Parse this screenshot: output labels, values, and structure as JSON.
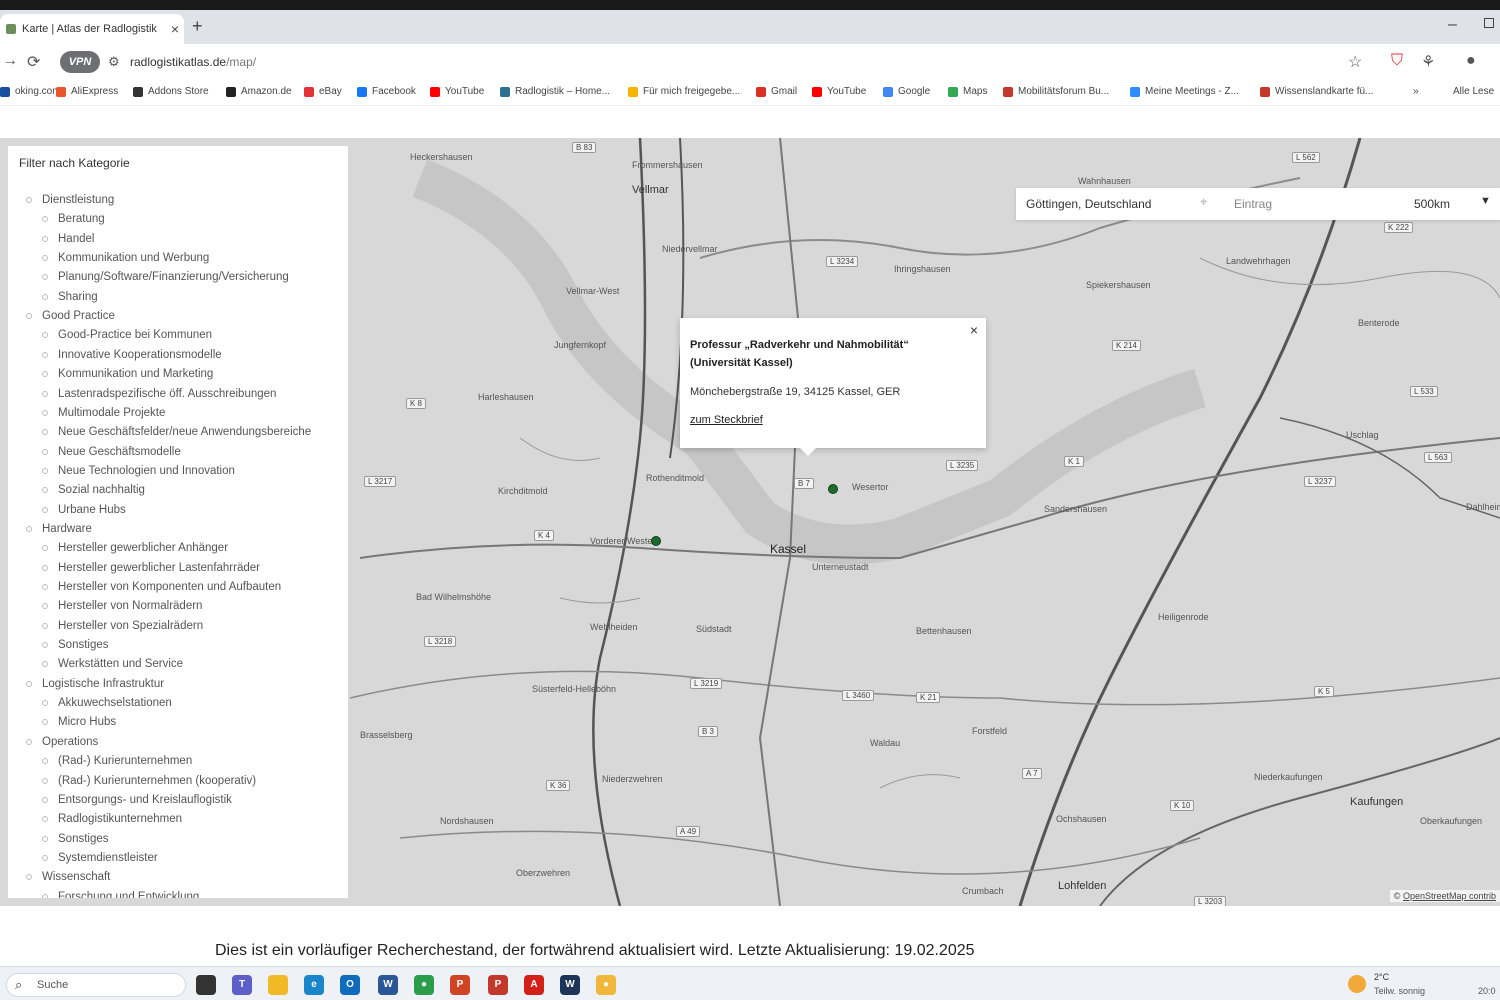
{
  "browser": {
    "tab_title": "Karte | Atlas der Radlogistik",
    "tab_close": "×",
    "new_tab": "+",
    "minimize": "–",
    "vpn_label": "VPN",
    "url_host": "radlogistikatlas.de",
    "url_path": "/map/"
  },
  "bookmarks": [
    {
      "label": "oking.com",
      "color": "#1a4fa0"
    },
    {
      "label": "AliExpress",
      "color": "#e8562a"
    },
    {
      "label": "Addons Store",
      "color": "#333333"
    },
    {
      "label": "Amazon.de",
      "color": "#222222"
    },
    {
      "label": "eBay",
      "color": "#e53238"
    },
    {
      "label": "Facebook",
      "color": "#1877f2"
    },
    {
      "label": "YouTube",
      "color": "#ff0000"
    },
    {
      "label": "Radlogistik – Home...",
      "color": "#2f6f8f"
    },
    {
      "label": "Für mich freigegebe...",
      "color": "#f4b400"
    },
    {
      "label": "Gmail",
      "color": "#d93025"
    },
    {
      "label": "YouTube",
      "color": "#ff0000"
    },
    {
      "label": "Google",
      "color": "#4285f4"
    },
    {
      "label": "Maps",
      "color": "#34a853"
    },
    {
      "label": "Mobilitätsforum Bu...",
      "color": "#c0392b"
    },
    {
      "label": "Meine Meetings - Z...",
      "color": "#2d8cff"
    },
    {
      "label": "Wissenslandkarte fü...",
      "color": "#c0392b"
    },
    {
      "label": "»",
      "color": "transparent"
    },
    {
      "label": "Alle Lese",
      "color": "transparent"
    }
  ],
  "filter": {
    "title": "Filter nach Kategorie",
    "categories": [
      {
        "label": "Dienstleistung",
        "level": 0
      },
      {
        "label": "Beratung",
        "level": 1
      },
      {
        "label": "Handel",
        "level": 1
      },
      {
        "label": "Kommunikation und Werbung",
        "level": 1
      },
      {
        "label": "Planung/Software/Finanzierung/Versicherung",
        "level": 1
      },
      {
        "label": "Sharing",
        "level": 1
      },
      {
        "label": "Good Practice",
        "level": 0
      },
      {
        "label": "Good-Practice bei Kommunen",
        "level": 1
      },
      {
        "label": "Innovative Kooperationsmodelle",
        "level": 1
      },
      {
        "label": "Kommunikation und Marketing",
        "level": 1
      },
      {
        "label": "Lastenradspezifische öff. Ausschreibungen",
        "level": 1
      },
      {
        "label": "Multimodale Projekte",
        "level": 1
      },
      {
        "label": "Neue Geschäftsfelder/neue Anwendungsbereiche",
        "level": 1
      },
      {
        "label": "Neue Geschäftsmodelle",
        "level": 1
      },
      {
        "label": "Neue Technologien und Innovation",
        "level": 1
      },
      {
        "label": "Sozial nachhaltig",
        "level": 1
      },
      {
        "label": "Urbane Hubs",
        "level": 1
      },
      {
        "label": "Hardware",
        "level": 0
      },
      {
        "label": "Hersteller gewerblicher Anhänger",
        "level": 1
      },
      {
        "label": "Hersteller gewerblicher Lastenfahrräder",
        "level": 1
      },
      {
        "label": "Hersteller von Komponenten und Aufbauten",
        "level": 1
      },
      {
        "label": "Hersteller von Normalrädern",
        "level": 1
      },
      {
        "label": "Hersteller von Spezialrädern",
        "level": 1
      },
      {
        "label": "Sonstiges",
        "level": 1
      },
      {
        "label": "Werkstätten und Service",
        "level": 1
      },
      {
        "label": "Logistische Infrastruktur",
        "level": 0
      },
      {
        "label": "Akkuwechselstationen",
        "level": 1
      },
      {
        "label": "Micro Hubs",
        "level": 1
      },
      {
        "label": "Operations",
        "level": 0
      },
      {
        "label": "(Rad-) Kurierunternehmen",
        "level": 1
      },
      {
        "label": "(Rad-) Kurierunternehmen (kooperativ)",
        "level": 1
      },
      {
        "label": "Entsorgungs- und Kreislauflogistik",
        "level": 1
      },
      {
        "label": "Radlogistikunternehmen",
        "level": 1
      },
      {
        "label": "Sonstiges",
        "level": 1
      },
      {
        "label": "Systemdienstleister",
        "level": 1
      },
      {
        "label": "Wissenschaft",
        "level": 0
      },
      {
        "label": "Forschung und Entwicklung",
        "level": 1
      }
    ]
  },
  "search": {
    "location": "Göttingen, Deutschland",
    "entry_placeholder": "Eintrag",
    "radius": "500km",
    "locate_icon": "crosshair-icon",
    "chevron_icon": "chevron-down-icon"
  },
  "popup": {
    "title": "Professur „Radverkehr und Nahmobilität“ (Universität Kassel)",
    "address": "Mönchebergstraße 19, 34125 Kassel, GER",
    "link": "zum Steckbrief",
    "close": "×"
  },
  "map": {
    "labels": [
      "Heckershausen",
      "Frommershausen",
      "Vellmar",
      "Niedervellmar",
      "Vellmar-West",
      "Jungfernkopf",
      "Harleshausen",
      "Kirchditmold",
      "Rothenditmold",
      "Wesertor",
      "Vorderer Westen",
      "Kassel",
      "Unterneustadt",
      "Bad Wilhelmshöhe",
      "Wehlheiden",
      "Südstadt",
      "Bettenhausen",
      "Heiligenrode",
      "Süsterfeld-Helleböhn",
      "Brasselsberg",
      "Waldau",
      "Forstfeld",
      "Niederzwehren",
      "Nordshausen",
      "Oberzwehren",
      "Crumbach",
      "Lohfelden",
      "Ochshausen",
      "Niederkaufungen",
      "Kaufungen",
      "Oberkaufungen",
      "Sandershausen",
      "Ihringshausen",
      "Spiekershausen",
      "Landwehrhagen",
      "Benterode",
      "Uschlag",
      "Wahnhausen",
      "Dahlheim"
    ],
    "roads": [
      "B 83",
      "L 3234",
      "K 8",
      "L 3217",
      "K 4",
      "B 7",
      "L 3235",
      "K 1",
      "L 3237",
      "L 3218",
      "L 3219",
      "L 3460",
      "K 21",
      "B 3",
      "A 49",
      "K 36",
      "A 7",
      "K 10",
      "K 5",
      "L 3203",
      "K 214",
      "L 533",
      "L 563",
      "L 562",
      "K 222"
    ],
    "attribution_prefix": "©",
    "attribution_link": "OpenStreetMap contrib"
  },
  "notice": "Dies ist ein vorläufiger Recherchestand, der fortwährend aktualisiert wird. Letzte Aktualisierung: 19.02.2025",
  "taskbar": {
    "search_label": "Suche",
    "weather_temp": "2°C",
    "weather_desc": "Teilw. sonnig",
    "clock": "20:0"
  }
}
